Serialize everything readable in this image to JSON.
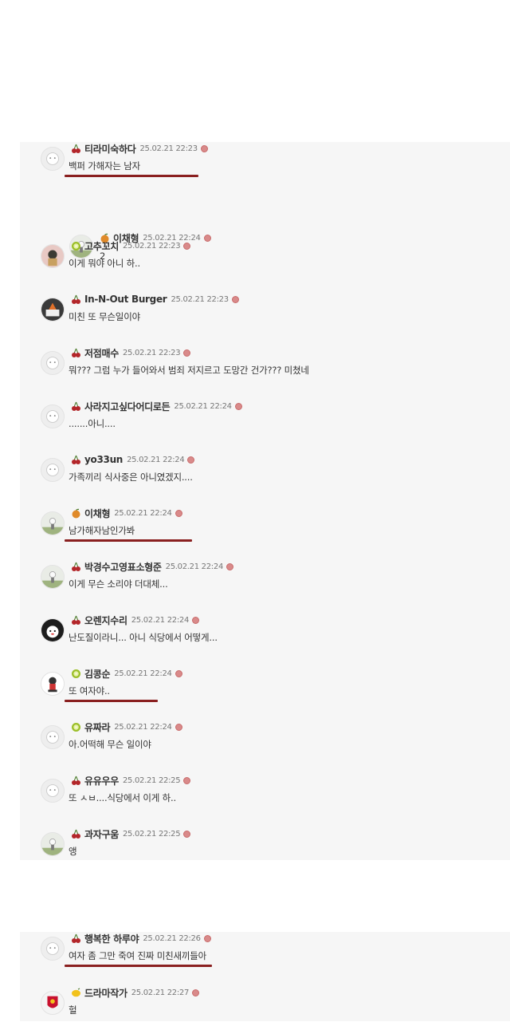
{
  "panel1_comments": [
    {
      "nickname": "티라미숙하다",
      "time": "25.02.21 22:23",
      "text": "백퍼 가해자는 남자",
      "badge": "cherry-icon",
      "reply": false,
      "underlined": true
    },
    {
      "nickname": "이채형",
      "time": "25.02.21 22:24",
      "text": "2",
      "badge": "orange-icon",
      "reply": true,
      "underlined": false
    },
    {
      "nickname": "고추꼬치",
      "time": "25.02.21 22:23",
      "text": "이게 뭐야 아니 하..",
      "badge": "kiwi-icon",
      "reply": false,
      "underlined": false
    },
    {
      "nickname": "In-N-Out Burger",
      "time": "25.02.21 22:23",
      "text": "미친 또 무슨일이야",
      "badge": "cherry-icon",
      "reply": false,
      "underlined": false
    },
    {
      "nickname": "저점매수",
      "time": "25.02.21 22:23",
      "text": "뭐??? 그럼 누가 들어와서 범죄 저지르고 도망간 건가??? 미쳤네",
      "badge": "cherry-icon",
      "reply": false,
      "underlined": false
    },
    {
      "nickname": "사라지고싶다어디로든",
      "time": "25.02.21 22:24",
      "text": ".......아니....",
      "badge": "cherry-icon",
      "reply": false,
      "underlined": false
    },
    {
      "nickname": "yo33un",
      "time": "25.02.21 22:24",
      "text": "가족끼리 식사중은 아니였겠지....",
      "badge": "cherry-icon",
      "reply": false,
      "underlined": false
    },
    {
      "nickname": "이채형",
      "time": "25.02.21 22:24",
      "text": "남가해자남인가봐",
      "badge": "orange-icon",
      "reply": false,
      "underlined": true
    },
    {
      "nickname": "박경수고영표소형준",
      "time": "25.02.21 22:24",
      "text": "이게 무슨 소리야 더대체...",
      "badge": "cherry-icon",
      "reply": false,
      "underlined": false
    },
    {
      "nickname": "오렌지수리",
      "time": "25.02.21 22:24",
      "text": "난도질이라니... 아니 식당에서 어떻게...",
      "badge": "cherry-icon",
      "reply": false,
      "underlined": false
    },
    {
      "nickname": "김콩순",
      "time": "25.02.21 22:24",
      "text": "또 여자야..",
      "badge": "kiwi-icon",
      "reply": false,
      "underlined": true
    },
    {
      "nickname": "유짜라",
      "time": "25.02.21 22:24",
      "text": "아.어떡해 무슨 일이야",
      "badge": "kiwi-icon",
      "reply": false,
      "underlined": false
    },
    {
      "nickname": "유유우우",
      "time": "25.02.21 22:25",
      "text": "또 ㅅㅂ....식당에서 이게 하..",
      "badge": "cherry-icon",
      "reply": false,
      "underlined": false
    },
    {
      "nickname": "과자구움",
      "time": "25.02.21 22:25",
      "text": "앵",
      "badge": "cherry-icon",
      "reply": false,
      "underlined": false
    }
  ],
  "panel2_comments": [
    {
      "nickname": "행복한 하루야",
      "time": "25.02.21 22:26",
      "text": "여자 좀 그만 죽여 진짜 미친새끼들아",
      "badge": "cherry-icon",
      "reply": false,
      "underlined": true
    },
    {
      "nickname": "드라마작가",
      "time": "25.02.21 22:27",
      "text": "헐",
      "badge": "lemon-icon",
      "reply": false,
      "underlined": false
    }
  ],
  "colors": {
    "panel_background": "#f6f6f6",
    "underline": "#8a2020",
    "report_dot": "#d98a8a",
    "cherry": "#b3262a",
    "orange": "#e08a2a",
    "kiwi": "#9cbf2a",
    "lemon": "#f2c21b"
  }
}
